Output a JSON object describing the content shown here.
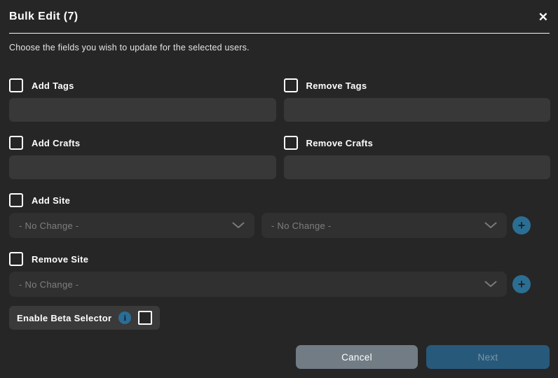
{
  "modal": {
    "title": "Bulk Edit (7)",
    "description": "Choose the fields you wish to update for the selected users."
  },
  "icons": {
    "close": "✕",
    "plus": "+",
    "info": "i",
    "chevron": "chevron-down"
  },
  "fields": {
    "add_tags": {
      "label": "Add Tags",
      "value": ""
    },
    "remove_tags": {
      "label": "Remove Tags",
      "value": ""
    },
    "add_crafts": {
      "label": "Add Crafts",
      "value": ""
    },
    "remove_crafts": {
      "label": "Remove Crafts",
      "value": ""
    },
    "add_site": {
      "label": "Add Site",
      "dropdown1_value": "- No Change -",
      "dropdown2_value": "- No Change -"
    },
    "remove_site": {
      "label": "Remove Site",
      "dropdown_value": "- No Change -"
    },
    "beta": {
      "label": "Enable Beta Selector"
    }
  },
  "footer": {
    "cancel_label": "Cancel",
    "next_label": "Next"
  },
  "colors": {
    "background": "#262626",
    "input_background": "#383838",
    "dropdown_background": "#303030",
    "accent_blue": "#2b6e93",
    "next_button": "#27597a",
    "cancel_button": "#717c84"
  }
}
